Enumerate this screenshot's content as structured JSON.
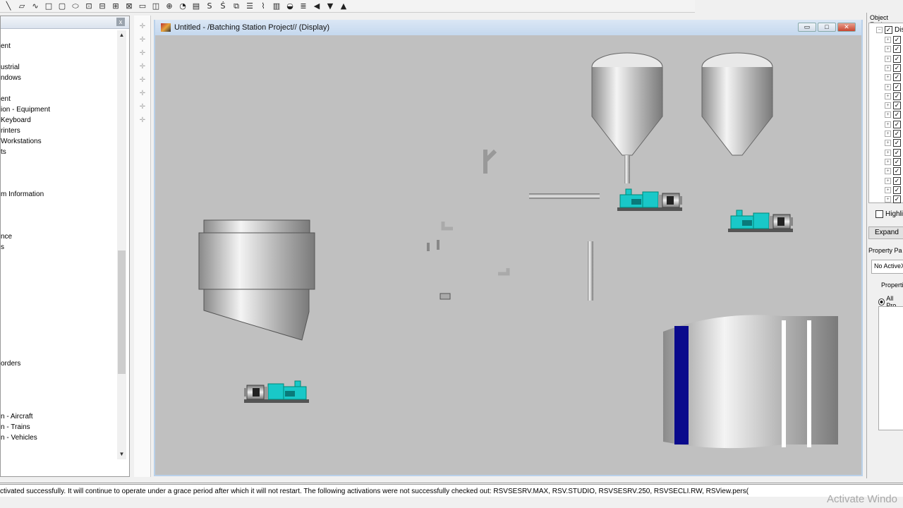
{
  "toolbar": {
    "icons": [
      "line",
      "polyline",
      "freehand",
      "rectangle",
      "rounded-rectangle",
      "ellipse",
      "button",
      "push-button",
      "multistate",
      "interlock",
      "numeric-input",
      "indicator",
      "symbol",
      "gauge",
      "numeric-display",
      "string-display",
      "string-input",
      "recipe",
      "control-list",
      "trend",
      "bar-graph",
      "scale",
      "list",
      "arrow-left",
      "arrow-down",
      "arrow-up"
    ]
  },
  "left_panel": {
    "items": [
      "ent",
      "",
      "ustrial",
      "ndows",
      "",
      "ent",
      "ion - Equipment",
      "Keyboard",
      "rinters",
      "Workstations",
      "ts",
      "",
      "",
      "",
      "m Information",
      "",
      "",
      "",
      "nce",
      "s",
      "",
      "",
      "",
      "",
      "",
      "",
      "",
      "",
      "",
      "",
      "orders",
      "",
      "",
      "",
      "",
      "n - Aircraft",
      "n - Trains",
      "n - Vehicles"
    ]
  },
  "window": {
    "title": "Untitled - /Batching Station Project// (Display)",
    "minimize": "▭",
    "maximize": "□",
    "close": "✕"
  },
  "right_panel": {
    "object_explorer_title": "Object Explo",
    "root_label": "Dis",
    "child_count": 18,
    "highlight_label": "Highlight",
    "expand_label": "Expand",
    "property_panel_title": "Property Pa",
    "no_active_label": "No ActiveX",
    "properties_label": "Properties",
    "all_properties_label": "All Pro"
  },
  "status": {
    "message": "ctivated successfully. It will continue to operate under a grace period after which it will not restart. The following activations were not successfully checked out: RSVSESRV.MAX, RSV.STUDIO, RSVSESRV.250, RSVSECLI.RW, RSView.pers("
  },
  "watermark": "Activate Windo",
  "colors": {
    "pump": "#19c8c8",
    "tank_stripe": "#0a0a8c",
    "canvas": "#c0c0c0"
  }
}
